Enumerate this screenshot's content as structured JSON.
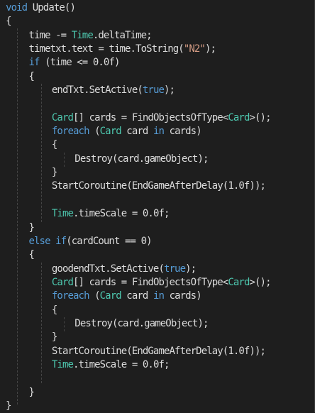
{
  "colors": {
    "background": "#1e1e1e",
    "default": "#dcdcdc",
    "keyword": "#569cd6",
    "type": "#4ec9b0",
    "string": "#d69d85",
    "number": "#b5cea8",
    "guide": "#454545"
  },
  "lines": [
    {
      "indent": 1,
      "tokens": [
        {
          "t": "void ",
          "c": "keyword"
        },
        {
          "t": "Update()",
          "c": "default"
        }
      ]
    },
    {
      "indent": 1,
      "tokens": [
        {
          "t": "{",
          "c": "default"
        }
      ]
    },
    {
      "indent": 5,
      "tokens": [
        {
          "t": "time -= ",
          "c": "default"
        },
        {
          "t": "Time",
          "c": "type"
        },
        {
          "t": ".deltaTime;",
          "c": "default"
        }
      ]
    },
    {
      "indent": 5,
      "tokens": [
        {
          "t": "timetxt.text = time.ToString(",
          "c": "default"
        },
        {
          "t": "\"N2\"",
          "c": "string"
        },
        {
          "t": ");",
          "c": "default"
        }
      ]
    },
    {
      "indent": 5,
      "tokens": [
        {
          "t": "if ",
          "c": "keyword"
        },
        {
          "t": "(time <= 0.0f)",
          "c": "default"
        }
      ]
    },
    {
      "indent": 5,
      "tokens": [
        {
          "t": "{",
          "c": "default"
        }
      ]
    },
    {
      "indent": 9,
      "tokens": [
        {
          "t": "endTxt.SetActive(",
          "c": "default"
        },
        {
          "t": "true",
          "c": "keyword"
        },
        {
          "t": ");",
          "c": "default"
        }
      ]
    },
    {
      "indent": 0,
      "tokens": []
    },
    {
      "indent": 9,
      "tokens": [
        {
          "t": "Card",
          "c": "type"
        },
        {
          "t": "[] cards = FindObjectsOfType<",
          "c": "default"
        },
        {
          "t": "Card",
          "c": "type"
        },
        {
          "t": ">();",
          "c": "default"
        }
      ]
    },
    {
      "indent": 9,
      "tokens": [
        {
          "t": "foreach ",
          "c": "keyword"
        },
        {
          "t": "(",
          "c": "default"
        },
        {
          "t": "Card",
          "c": "type"
        },
        {
          "t": " card ",
          "c": "default"
        },
        {
          "t": "in ",
          "c": "keyword"
        },
        {
          "t": "cards)",
          "c": "default"
        }
      ]
    },
    {
      "indent": 9,
      "tokens": [
        {
          "t": "{",
          "c": "default"
        }
      ]
    },
    {
      "indent": 13,
      "tokens": [
        {
          "t": "Destroy(card.gameObject);",
          "c": "default"
        }
      ]
    },
    {
      "indent": 9,
      "tokens": [
        {
          "t": "}",
          "c": "default"
        }
      ]
    },
    {
      "indent": 9,
      "tokens": [
        {
          "t": "StartCoroutine(EndGameAfterDelay(1.0f));",
          "c": "default"
        }
      ]
    },
    {
      "indent": 0,
      "tokens": []
    },
    {
      "indent": 9,
      "tokens": [
        {
          "t": "Time",
          "c": "type"
        },
        {
          "t": ".timeScale = 0.0f;",
          "c": "default"
        }
      ]
    },
    {
      "indent": 5,
      "tokens": [
        {
          "t": "}",
          "c": "default"
        }
      ]
    },
    {
      "indent": 5,
      "tokens": [
        {
          "t": "else if",
          "c": "keyword"
        },
        {
          "t": "(cardCount == 0)",
          "c": "default"
        }
      ]
    },
    {
      "indent": 5,
      "tokens": [
        {
          "t": "{",
          "c": "default"
        }
      ]
    },
    {
      "indent": 9,
      "tokens": [
        {
          "t": "goodendTxt.SetActive(",
          "c": "default"
        },
        {
          "t": "true",
          "c": "keyword"
        },
        {
          "t": ");",
          "c": "default"
        }
      ]
    },
    {
      "indent": 9,
      "tokens": [
        {
          "t": "Card",
          "c": "type"
        },
        {
          "t": "[] cards = FindObjectsOfType<",
          "c": "default"
        },
        {
          "t": "Card",
          "c": "type"
        },
        {
          "t": ">();",
          "c": "default"
        }
      ]
    },
    {
      "indent": 9,
      "tokens": [
        {
          "t": "foreach ",
          "c": "keyword"
        },
        {
          "t": "(",
          "c": "default"
        },
        {
          "t": "Card",
          "c": "type"
        },
        {
          "t": " card ",
          "c": "default"
        },
        {
          "t": "in ",
          "c": "keyword"
        },
        {
          "t": "cards)",
          "c": "default"
        }
      ]
    },
    {
      "indent": 9,
      "tokens": [
        {
          "t": "{",
          "c": "default"
        }
      ]
    },
    {
      "indent": 13,
      "tokens": [
        {
          "t": "Destroy(card.gameObject);",
          "c": "default"
        }
      ]
    },
    {
      "indent": 9,
      "tokens": [
        {
          "t": "}",
          "c": "default"
        }
      ]
    },
    {
      "indent": 9,
      "tokens": [
        {
          "t": "StartCoroutine(EndGameAfterDelay(1.0f));",
          "c": "default"
        }
      ]
    },
    {
      "indent": 9,
      "tokens": [
        {
          "t": "Time",
          "c": "type"
        },
        {
          "t": ".timeScale = 0.0f;",
          "c": "default"
        }
      ]
    },
    {
      "indent": 0,
      "tokens": []
    },
    {
      "indent": 5,
      "tokens": [
        {
          "t": "}",
          "c": "default"
        }
      ]
    },
    {
      "indent": 1,
      "tokens": [
        {
          "t": "}",
          "c": "default"
        }
      ]
    }
  ]
}
